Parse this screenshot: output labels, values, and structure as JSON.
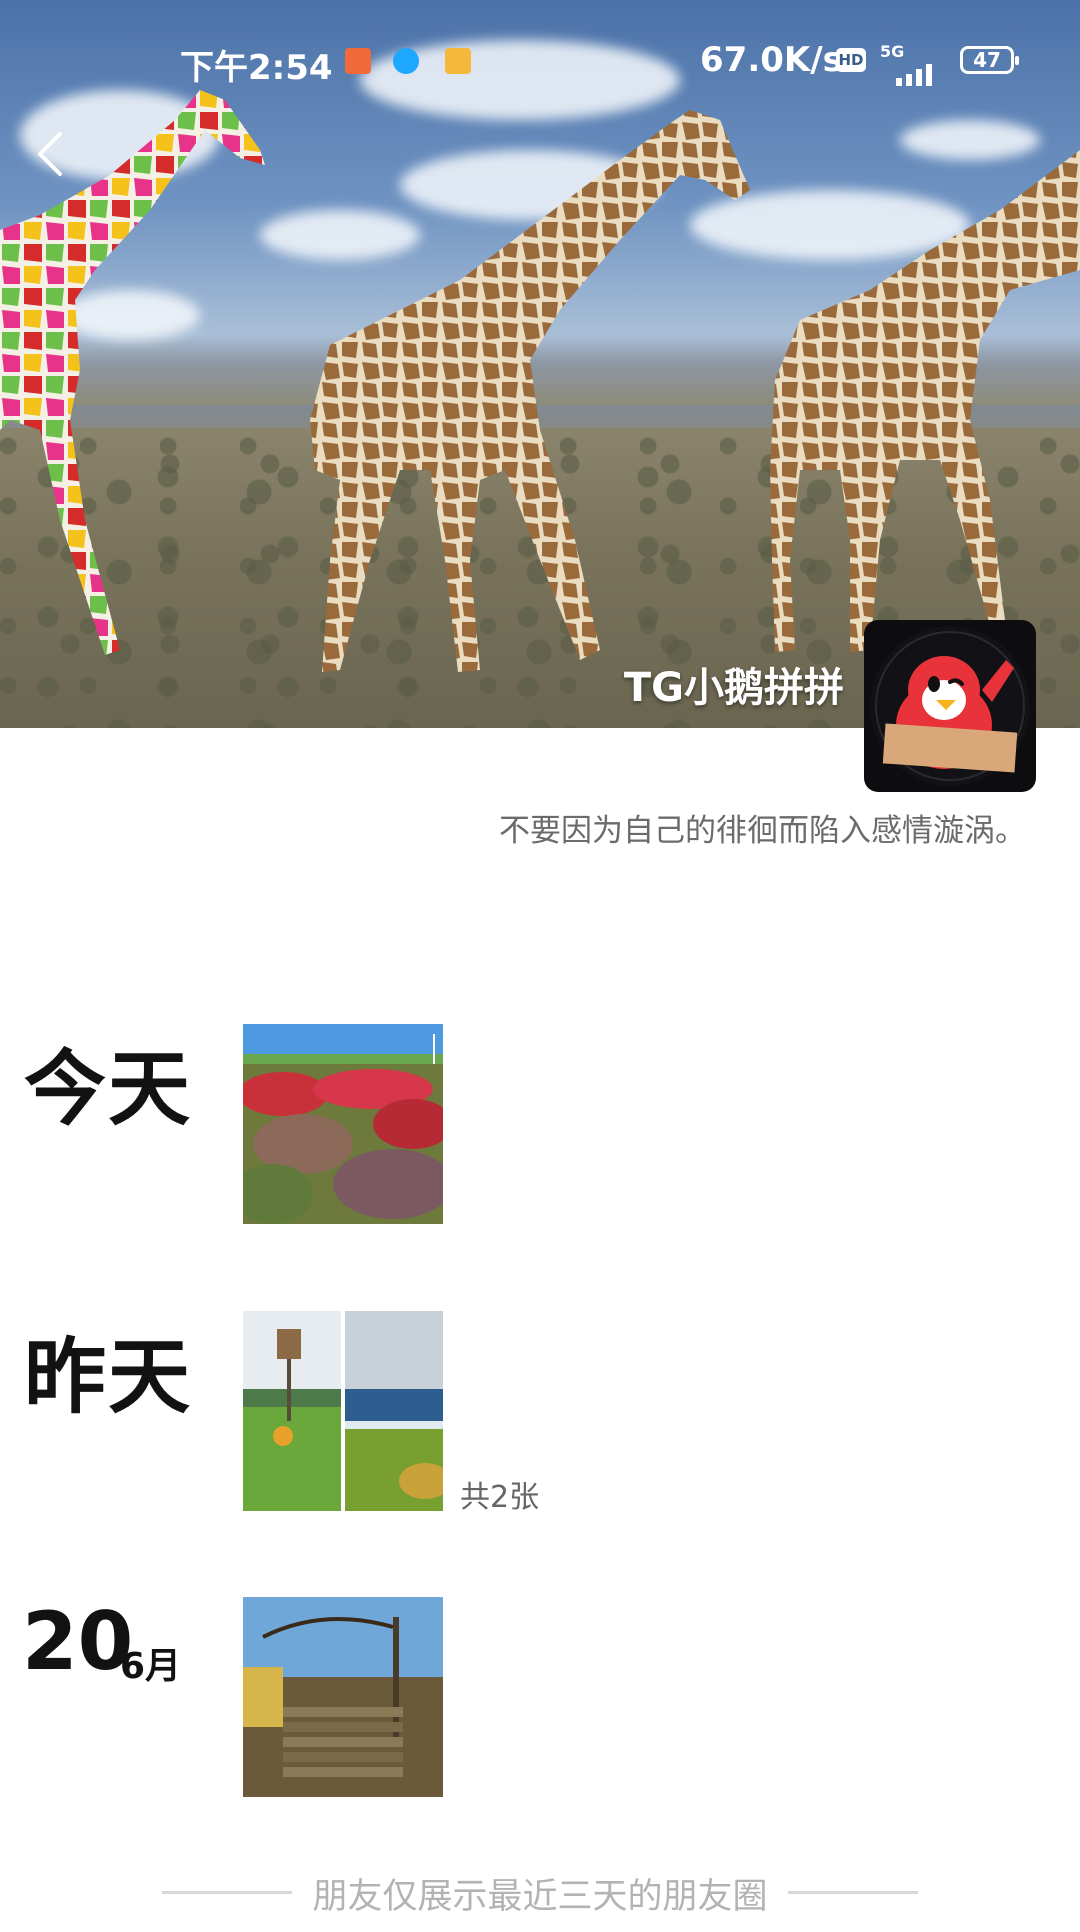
{
  "status_bar": {
    "time": "下午2:54",
    "network_speed": "67.0K/s",
    "hd_label": "HD",
    "signal_label": "5G",
    "battery": "47"
  },
  "profile": {
    "nickname": "TG小鹅拼拼",
    "signature": "不要因为自己的徘徊而陷入感情漩涡。"
  },
  "timeline": [
    {
      "label": "今天",
      "photo_count_text": ""
    },
    {
      "label": "昨天",
      "photo_count_text": "共2张"
    },
    {
      "day": "20",
      "month": "6月"
    }
  ],
  "footer": {
    "text": "朋友仅展示最近三天的朋友圈"
  },
  "icons": {
    "back": "back-arrow-icon",
    "avatar": "penguin-avatar"
  },
  "colors": {
    "accent_avatar_bg": "#0d0d10",
    "penguin_red": "#e8333a",
    "footer_text": "#b3b3b3"
  }
}
